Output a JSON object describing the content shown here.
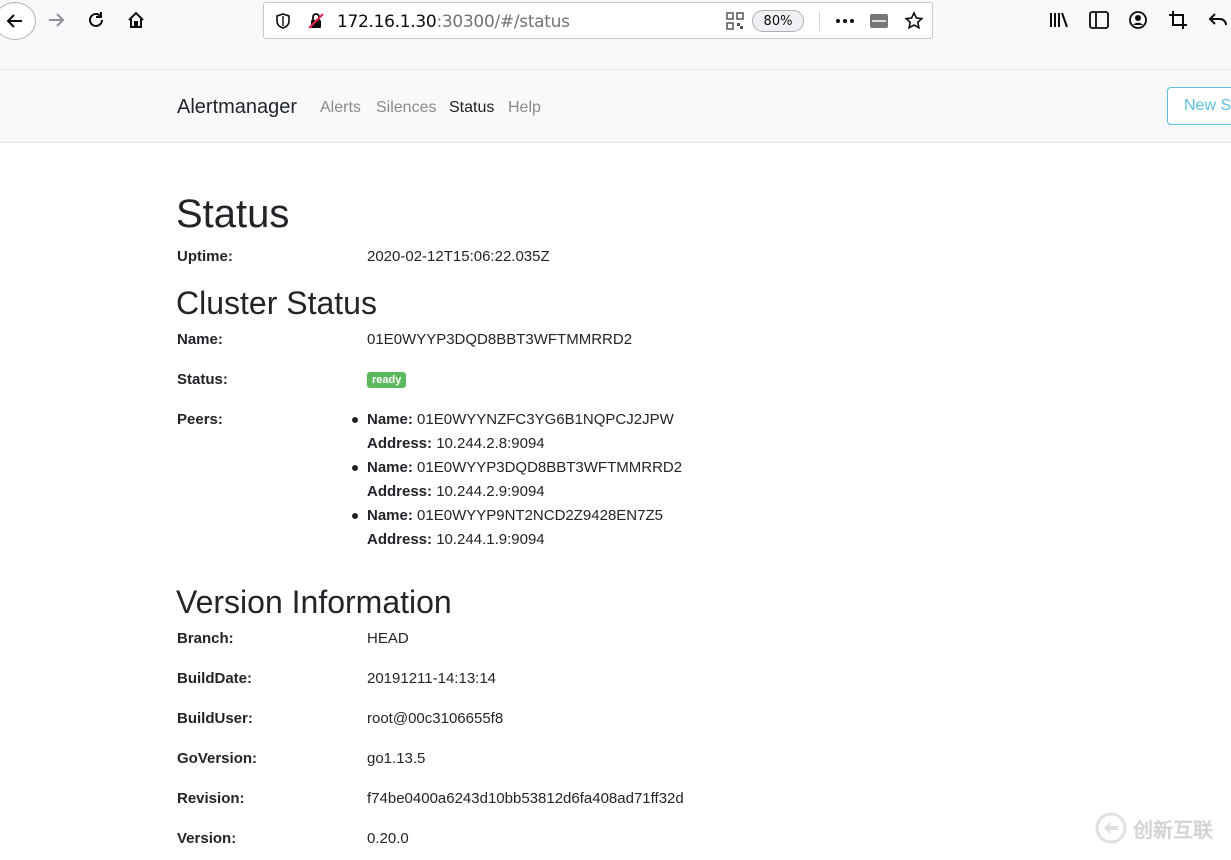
{
  "browser": {
    "url_host": "172.16.1.30",
    "url_rest": ":30300/#/status",
    "zoom": "80%"
  },
  "navbar": {
    "brand": "Alertmanager",
    "links": [
      "Alerts",
      "Silences",
      "Status",
      "Help"
    ],
    "active": "Status",
    "new_silence": "New Silence"
  },
  "status": {
    "title": "Status",
    "uptime_label": "Uptime:",
    "uptime": "2020-02-12T15:06:22.035Z"
  },
  "cluster": {
    "title": "Cluster Status",
    "name_label": "Name:",
    "name": "01E0WYYP3DQD8BBT3WFTMMRRD2",
    "status_label": "Status:",
    "status": "ready",
    "peers_label": "Peers:",
    "peer_name_label": "Name:",
    "peer_address_label": "Address:",
    "peers": [
      {
        "name": "01E0WYYNZFC3YG6B1NQPCJ2JPW",
        "address": "10.244.2.8:9094"
      },
      {
        "name": "01E0WYYP3DQD8BBT3WFTMMRRD2",
        "address": "10.244.2.9:9094"
      },
      {
        "name": "01E0WYYP9NT2NCD2Z9428EN7Z5",
        "address": "10.244.1.9:9094"
      }
    ]
  },
  "version": {
    "title": "Version Information",
    "rows": [
      {
        "label": "Branch:",
        "value": "HEAD"
      },
      {
        "label": "BuildDate:",
        "value": "20191211-14:13:14"
      },
      {
        "label": "BuildUser:",
        "value": "root@00c3106655f8"
      },
      {
        "label": "GoVersion:",
        "value": "go1.13.5"
      },
      {
        "label": "Revision:",
        "value": "f74be0400a6243d10bb53812d6fa408ad71ff32d"
      },
      {
        "label": "Version:",
        "value": "0.20.0"
      }
    ]
  },
  "watermark": {
    "text": "创新互联"
  },
  "colors": {
    "ready": "#5cb85c",
    "info": "#5bc0de"
  }
}
